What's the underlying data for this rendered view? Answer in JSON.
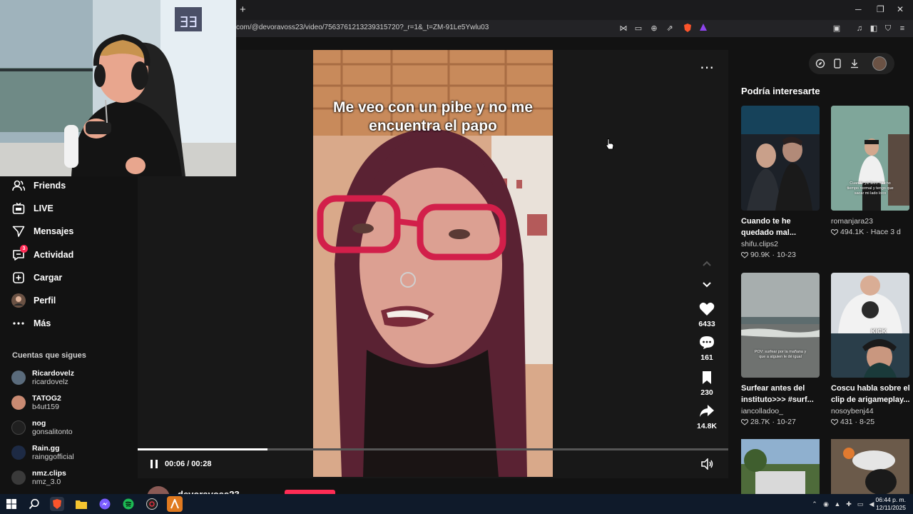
{
  "browser": {
    "new_tab": "+",
    "url": "com/@devoravoss23/video/7563761213239315720?_r=1&_t=ZM-91Le5Ywlu03",
    "window_controls": [
      "─",
      "❐",
      "✕"
    ]
  },
  "sidebar": {
    "items": [
      {
        "label": "Friends",
        "icon": "friends-icon"
      },
      {
        "label": "LIVE",
        "icon": "live-icon"
      },
      {
        "label": "Mensajes",
        "icon": "messages-icon"
      },
      {
        "label": "Actividad",
        "icon": "activity-icon",
        "badge": "3"
      },
      {
        "label": "Cargar",
        "icon": "upload-icon"
      },
      {
        "label": "Perfil",
        "icon": "profile-avatar"
      },
      {
        "label": "Más",
        "icon": "more-icon"
      }
    ],
    "following_title": "Cuentas que sigues",
    "following": [
      {
        "name": "Ricardovelz",
        "handle": "ricardovelz",
        "color": "#5a6b7c"
      },
      {
        "name": "TATOG2",
        "handle": "b4ut159",
        "color": "#c98a72"
      },
      {
        "name": "nog",
        "handle": "gonsalitonto",
        "color": "#202020"
      },
      {
        "name": "Rain.gg",
        "handle": "rainggofficial",
        "color": "#1d2a44"
      },
      {
        "name": "nmz.clips",
        "handle": "nmz_3.0",
        "color": "#3a3a3a"
      }
    ]
  },
  "video": {
    "caption_line1": "Me veo con un pibe y no me",
    "caption_line2": "encuentra el papo",
    "likes": "6433",
    "comments": "161",
    "saves": "230",
    "shares": "14.8K",
    "time": "00:06 / 00:28",
    "progress": 0.22,
    "author": "devoravoss23"
  },
  "recommended": {
    "title": "Podría interesarte",
    "cards": [
      {
        "title": "Cuando te he",
        "title2": "quedado mal...",
        "user": "shifu.clips2",
        "likes": "90.9K",
        "date": "10-23",
        "thumb_text": ""
      },
      {
        "title": "",
        "title2": "",
        "user": "romanjara23",
        "likes": "494.1K",
        "date": "Hace 3 d",
        "thumb_text": "Cuando ya llevo mucho tiempo normal y tengo que sacar mi lado loco"
      },
      {
        "title": "Surfear antes del",
        "title2": "instituto>>> #surf...",
        "user": "iancolladoo_",
        "likes": "28.7K",
        "date": "10-27",
        "thumb_text": "POV: surfear por la mañana y que a alguien le dé igual"
      },
      {
        "title": "Coscu habla sobre el",
        "title2": "clip de arigameplay...",
        "user": "nosoybenj44",
        "likes": "431",
        "date": "8-25",
        "thumb_text": "KICK"
      }
    ]
  },
  "taskbar": {
    "time": "06:44 p. m.",
    "date": "12/11/2025"
  }
}
